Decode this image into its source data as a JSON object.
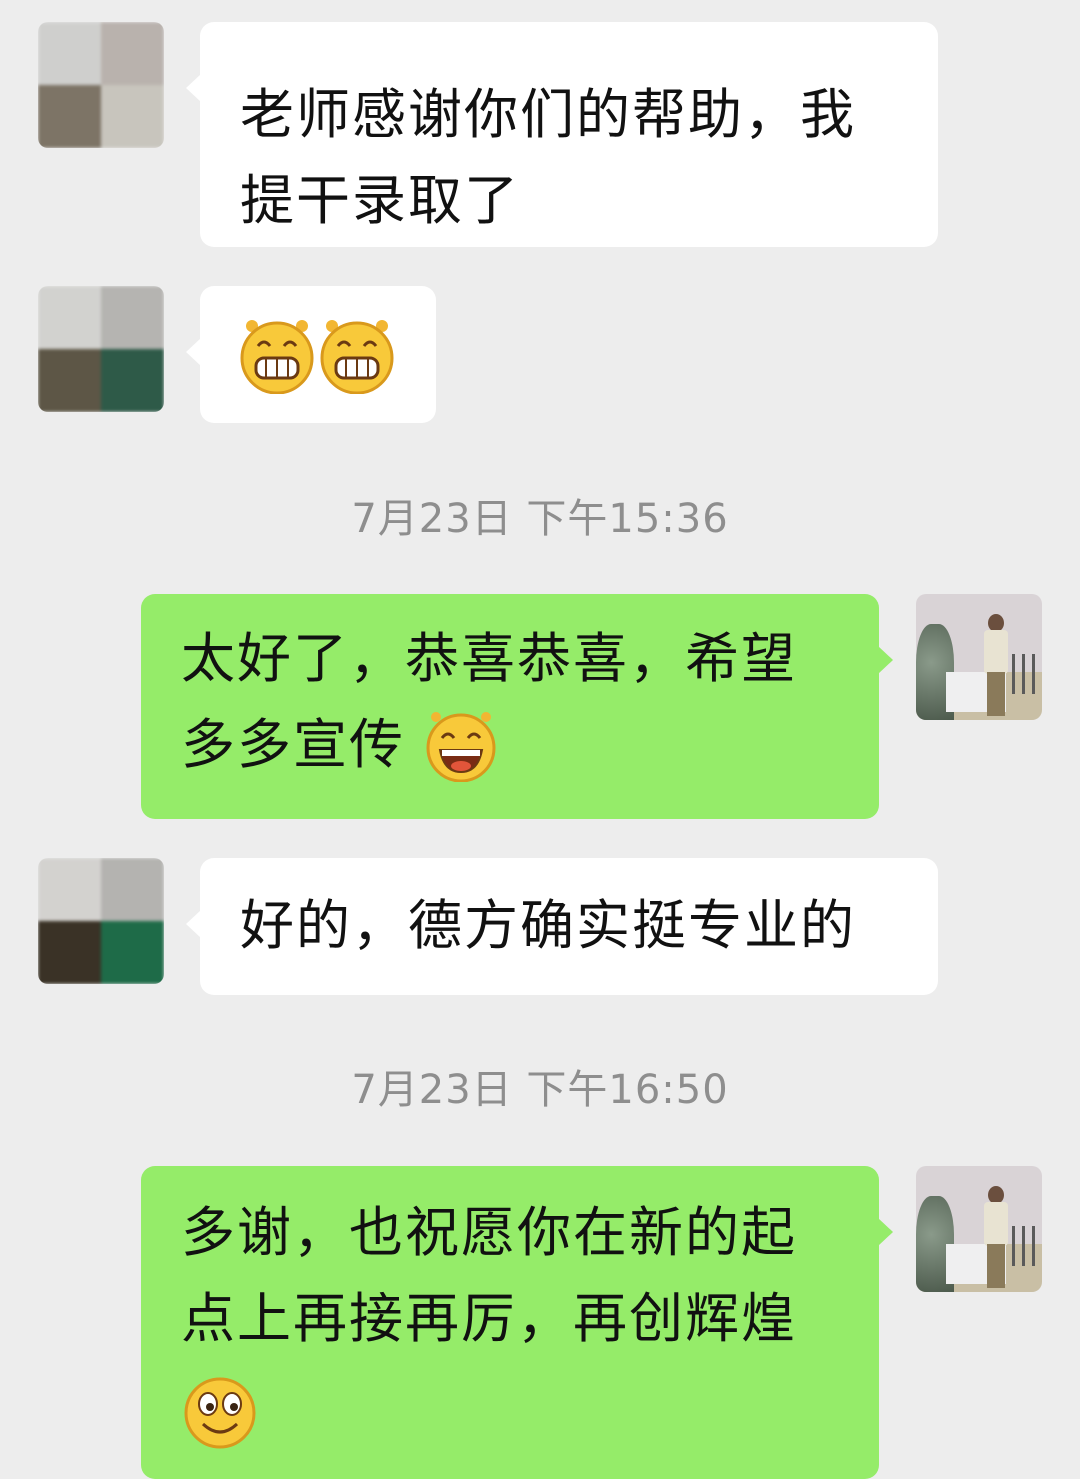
{
  "messages": [
    {
      "type": "in",
      "text": "老师感谢你们的帮助，我\n提干录取了"
    },
    {
      "type": "in",
      "emojis": [
        "grin-emoji",
        "grin-emoji"
      ]
    },
    {
      "type": "timestamp",
      "text": "7月23日 下午15:36"
    },
    {
      "type": "out",
      "text": "太好了，恭喜恭喜，希望\n多多宣传",
      "emoji": "laugh-emoji"
    },
    {
      "type": "in",
      "text": "好的，德方确实挺专业的"
    },
    {
      "type": "timestamp",
      "text": "7月23日 下午16:50"
    },
    {
      "type": "out",
      "text": "多谢，也祝愿你在新的起\n点上再接再厉，再创辉煌",
      "emoji": "smile-emoji"
    }
  ],
  "colors": {
    "background": "#ededed",
    "incoming_bubble": "#ffffff",
    "outgoing_bubble": "#95ec69",
    "timestamp_text": "#8e8e8e"
  }
}
